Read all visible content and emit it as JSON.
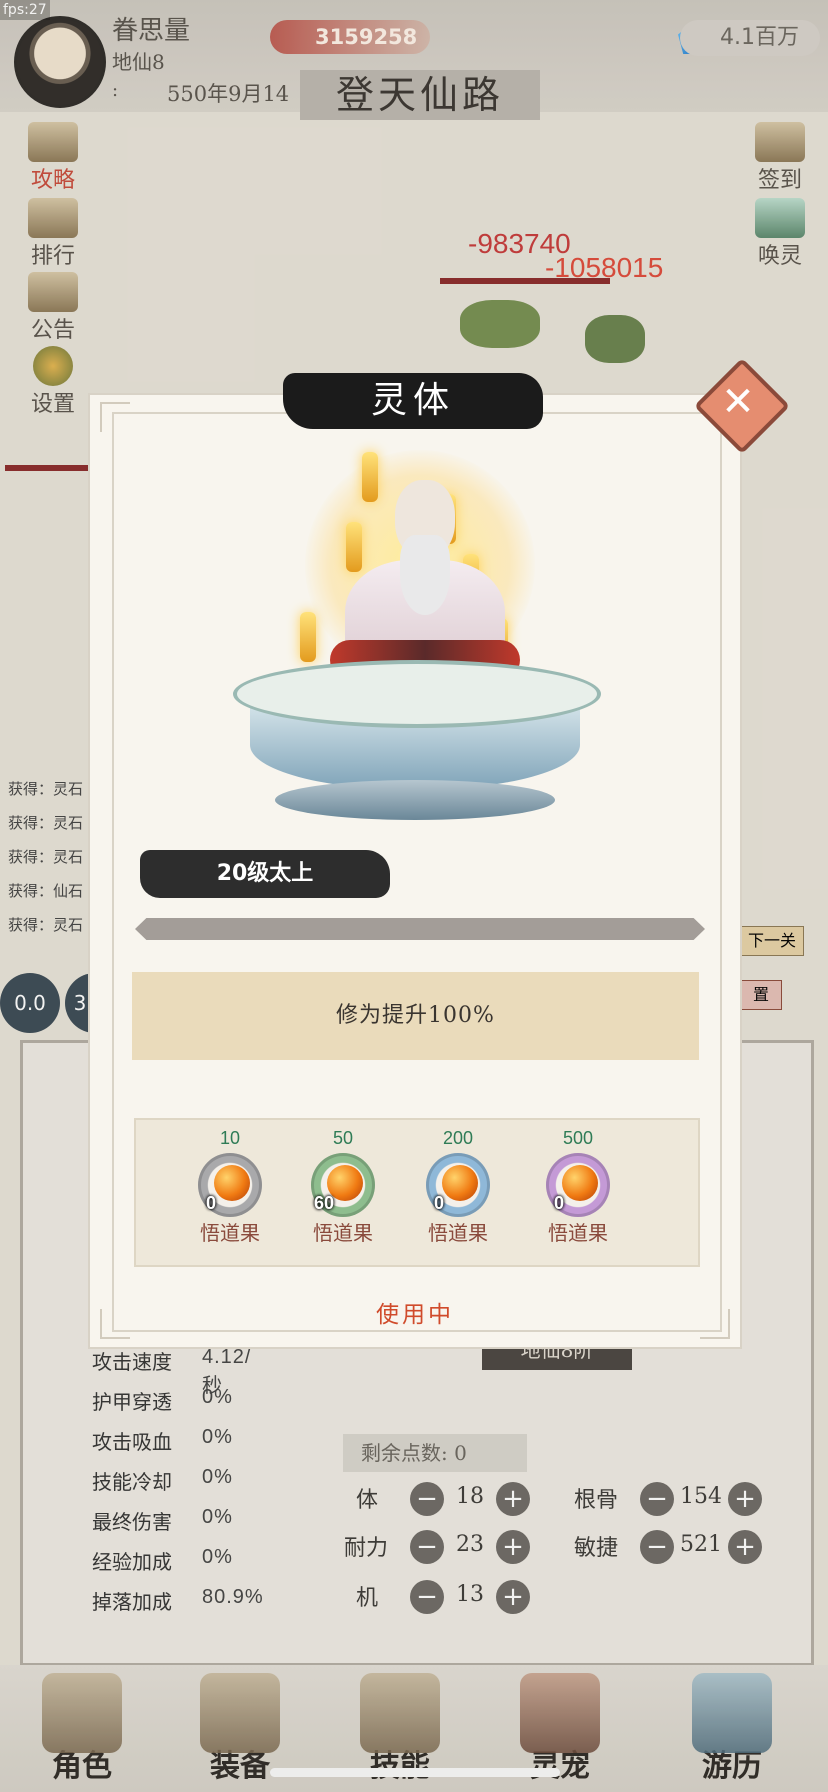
{
  "fps_label": "fps:27",
  "player": {
    "name": "眷思量",
    "realm": "地仙8",
    "date_prefix": ":",
    "date": "550年9月14"
  },
  "currency": {
    "power_value": "3159258",
    "gems_value": "4.1百万"
  },
  "stage_title": "登天仙路",
  "left_menu": [
    {
      "label": "攻略",
      "icon": "scroll-icon"
    },
    {
      "label": "排行",
      "icon": "ranking-scroll-icon"
    },
    {
      "label": "公告",
      "icon": "announcement-icon"
    },
    {
      "label": "设置",
      "icon": "settings-flower-icon"
    }
  ],
  "right_menu": [
    {
      "label": "签到",
      "icon": "checkin-scroll-icon"
    },
    {
      "label": "唤灵",
      "icon": "summon-icon"
    }
  ],
  "damage_numbers": [
    "-983740",
    "-1058015"
  ],
  "loot_log": [
    "获得：灵石",
    "获得：灵石",
    "获得：灵石",
    "获得：仙石",
    "获得：灵石"
  ],
  "side_buttons": {
    "next_level": "下一关",
    "reset": "置"
  },
  "speed_chips": [
    "0.0",
    "3"
  ],
  "stats": [
    {
      "label": "攻击速度",
      "value": "4.12/秒"
    },
    {
      "label": "护甲穿透",
      "value": "0%"
    },
    {
      "label": "攻击吸血",
      "value": "0%"
    },
    {
      "label": "技能冷却",
      "value": "0%"
    },
    {
      "label": "最终伤害",
      "value": "0%"
    },
    {
      "label": "经验加成",
      "value": "0%"
    },
    {
      "label": "掉落加成",
      "value": "80.9%"
    }
  ],
  "realm_tab": "地仙8阶",
  "remaining_points": {
    "label": "剩余点数:",
    "value": "0"
  },
  "attributes": [
    {
      "label": "体",
      "value": "18"
    },
    {
      "label": "根骨",
      "value": "154"
    },
    {
      "label": "耐力",
      "value": "23"
    },
    {
      "label": "敏捷",
      "value": "521"
    },
    {
      "label": "机",
      "value": "13"
    }
  ],
  "bottom_nav": [
    {
      "label": "角色",
      "icon": "character-icon"
    },
    {
      "label": "装备",
      "icon": "equipment-icon"
    },
    {
      "label": "技能",
      "icon": "skill-scroll-icon"
    },
    {
      "label": "灵宠",
      "icon": "pet-fox-icon"
    },
    {
      "label": "游历",
      "icon": "travel-mountain-icon"
    }
  ],
  "modal": {
    "title": "灵体",
    "level_label": "20级太上",
    "progress_fraction": 1.0,
    "effect_text": "修为提升100%",
    "fruits": [
      {
        "requirement": "10",
        "count": "0",
        "name": "悟道果",
        "ring_color": "#a9a9ab"
      },
      {
        "requirement": "50",
        "count": "60",
        "name": "悟道果",
        "ring_color": "#8ebd8e"
      },
      {
        "requirement": "200",
        "count": "0",
        "name": "悟道果",
        "ring_color": "#8fb8d8"
      },
      {
        "requirement": "500",
        "count": "0",
        "name": "悟道果",
        "ring_color": "#c49ad6"
      }
    ],
    "status": "使用中"
  },
  "colors": {
    "accent_red": "#d04b2b",
    "effect_bg": "#eadbbb",
    "fruit_requirement_green": "#2f7c56"
  }
}
